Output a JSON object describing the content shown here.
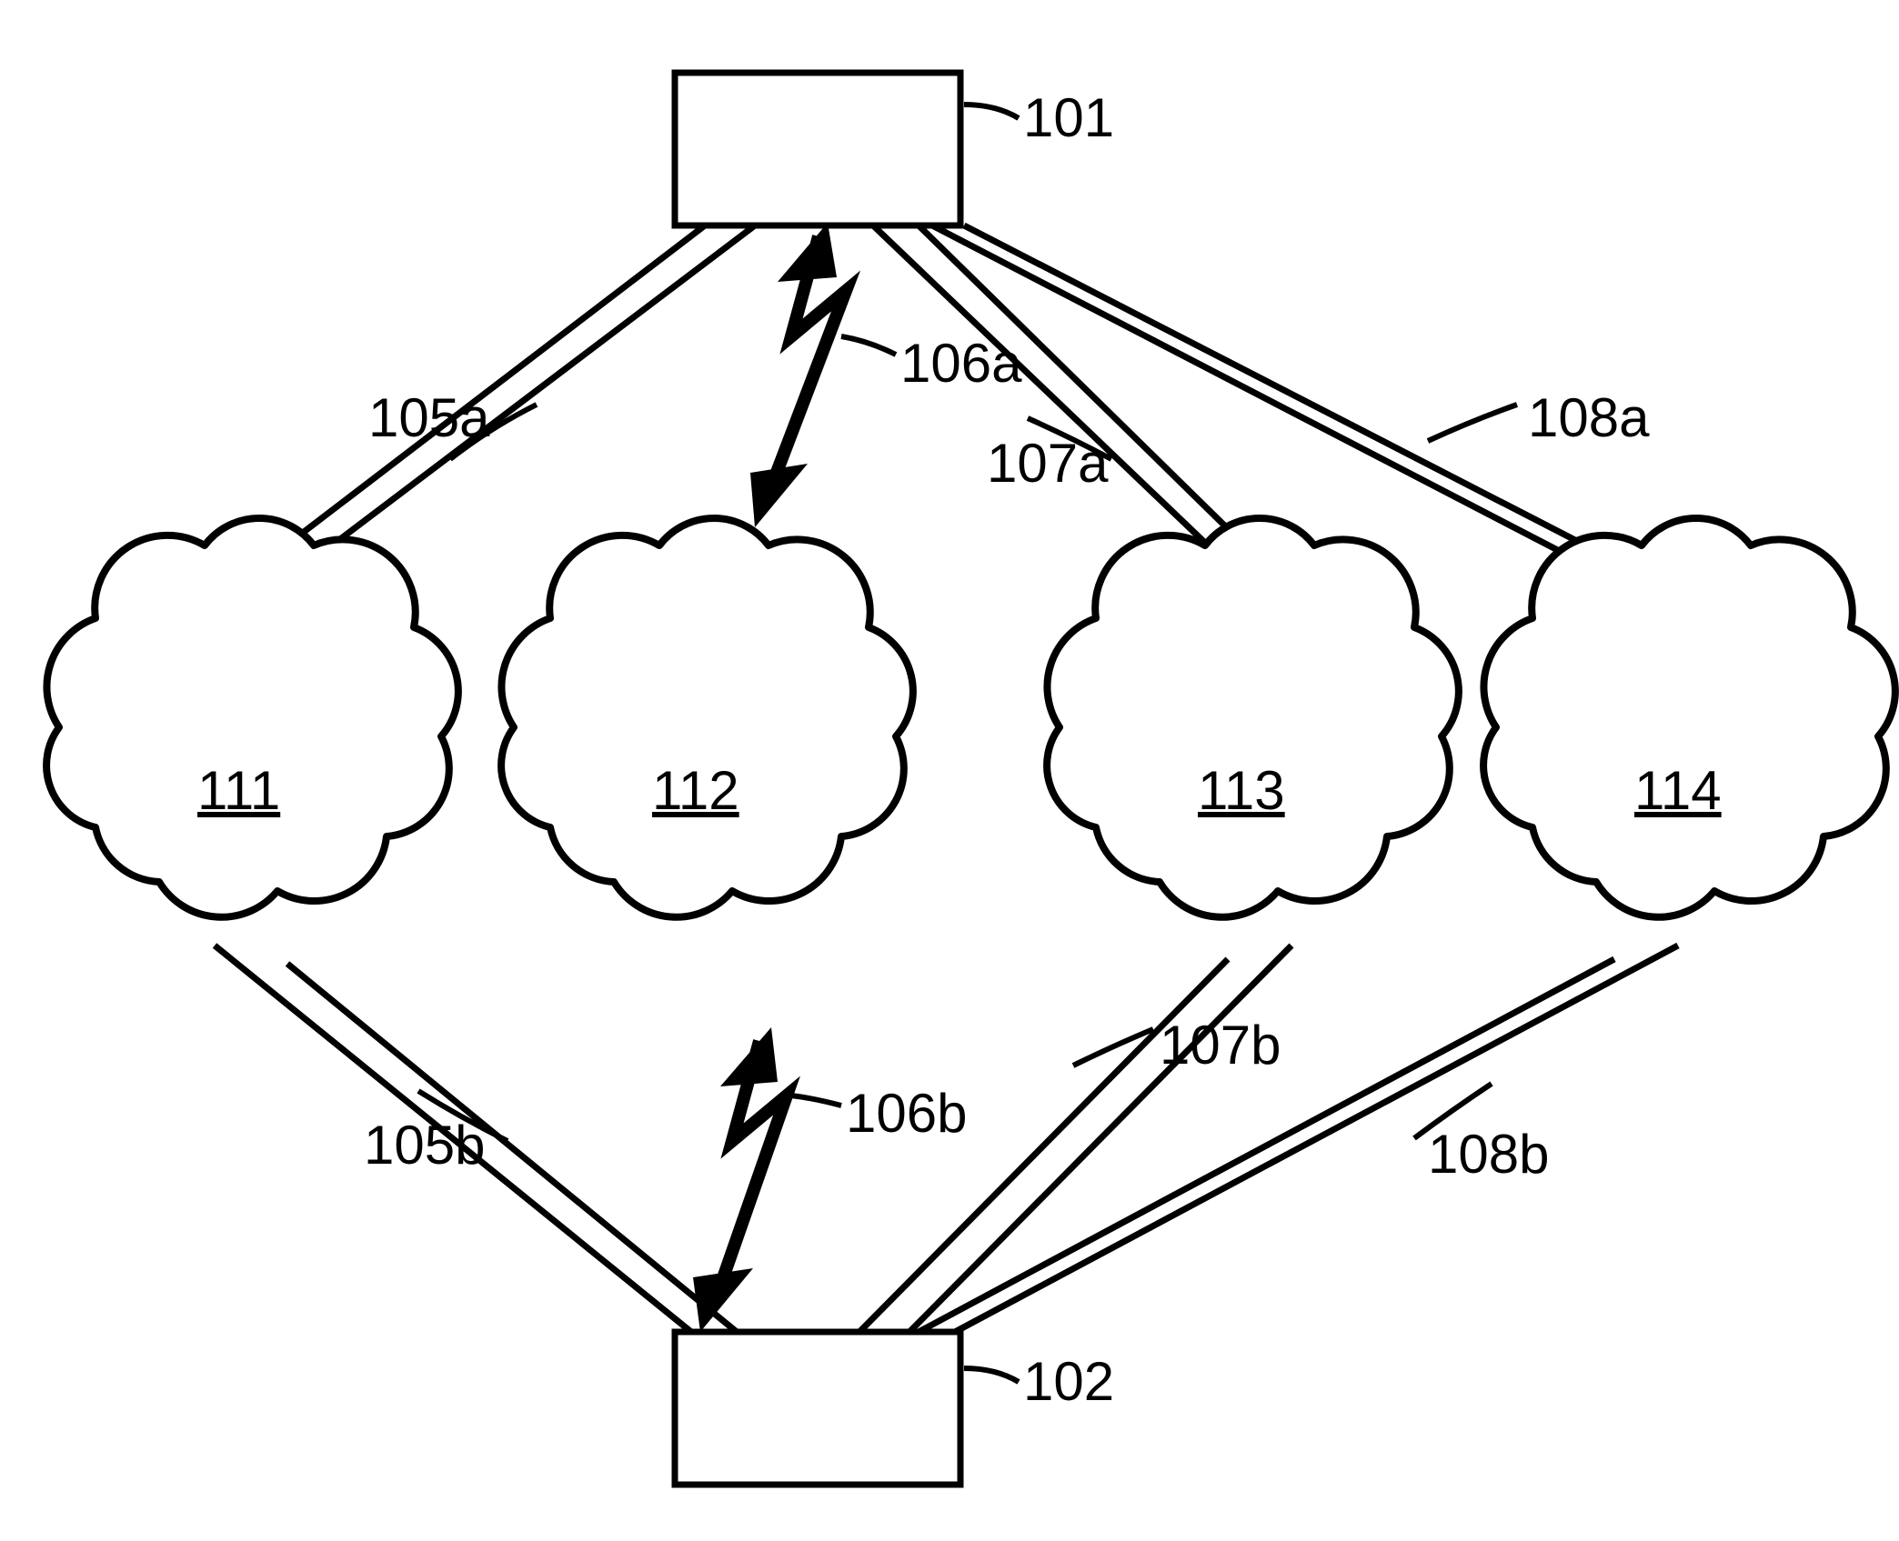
{
  "boxes": {
    "top": {
      "label": "101"
    },
    "bottom": {
      "label": "102"
    }
  },
  "clouds": {
    "c1": {
      "label": "111"
    },
    "c2": {
      "label": "112"
    },
    "c3": {
      "label": "113"
    },
    "c4": {
      "label": "114"
    }
  },
  "links": {
    "l105a": {
      "label": "105a"
    },
    "l106a": {
      "label": "106a"
    },
    "l107a": {
      "label": "107a"
    },
    "l108a": {
      "label": "108a"
    },
    "l105b": {
      "label": "105b"
    },
    "l106b": {
      "label": "106b"
    },
    "l107b": {
      "label": "107b"
    },
    "l108b": {
      "label": "108b"
    }
  }
}
